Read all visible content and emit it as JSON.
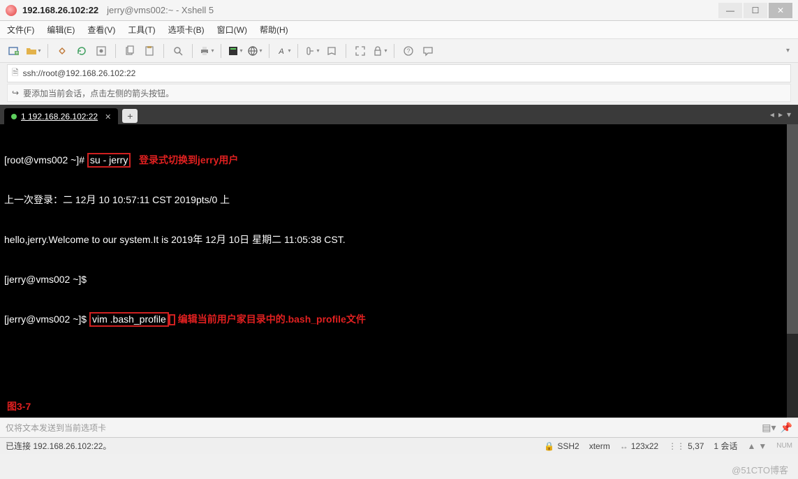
{
  "window": {
    "title_main": "192.168.26.102:22",
    "title_sub": "jerry@vms002:~ - Xshell 5"
  },
  "menu": {
    "file": "文件(F)",
    "edit": "编辑(E)",
    "view": "查看(V)",
    "tools": "工具(T)",
    "tab": "选项卡(B)",
    "window": "窗口(W)",
    "help": "帮助(H)"
  },
  "address": {
    "url": "ssh://root@192.168.26.102:22"
  },
  "infobar": {
    "text": "要添加当前会话，点击左侧的箭头按钮。"
  },
  "tabs": {
    "active": "1 192.168.26.102:22",
    "add": "+"
  },
  "terminal": {
    "line1_prompt": "[root@vms002 ~]# ",
    "line1_cmd": "su - jerry",
    "line1_anno": "登录式切换到jerry用户",
    "line2": "上一次登录：二 12月 10 10:57:11 CST 2019pts/0 上",
    "line3": "hello,jerry.Welcome to our system.It is 2019年 12月 10日 星期二 11:05:38 CST.",
    "line4": "[jerry@vms002 ~]$",
    "line5_prompt": "[jerry@vms002 ~]$ ",
    "line5_cmd": "vim .bash_profile",
    "line5_anno": "编辑当前用户家目录中的.bash_profile文件",
    "fig": "图3-7"
  },
  "sendbar": {
    "placeholder": "仅将文本发送到当前选项卡"
  },
  "status": {
    "conn": "已连接 192.168.26.102:22。",
    "ssh": "SSH2",
    "term": "xterm",
    "size": "123x22",
    "cursor": "5,37",
    "sessions": "1 会话"
  },
  "watermark": "@51CTO博客"
}
